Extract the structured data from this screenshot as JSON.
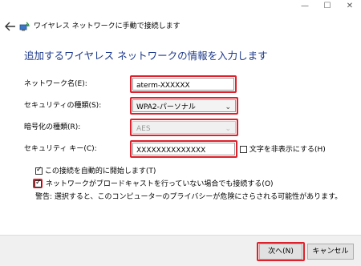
{
  "window": {
    "title": "ワイヤレス ネットワークに手動で接続します",
    "minimize": "—",
    "maximize": "☐",
    "close": "✕",
    "back_icon": "arrow-left-icon"
  },
  "heading": "追加するワイヤレス ネットワークの情報を入力します",
  "form": {
    "network_name_label": "ネットワーク名(E):",
    "network_name_value": "aterm-XXXXXX",
    "security_type_label": "セキュリティの種類(S):",
    "security_type_value": "WPA2-パーソナル",
    "encryption_label": "暗号化の種類(R):",
    "encryption_value": "AES",
    "security_key_label": "セキュリティ キー(C):",
    "security_key_value": "XXXXXXXXXXXXXX",
    "hide_chars_label": "文字を非表示にする(H)"
  },
  "options": {
    "auto_connect_label": "この接続を自動的に開始します(T)",
    "auto_connect_checked": true,
    "connect_hidden_label": "ネットワークがブロードキャストを行っていない場合でも接続する(O)",
    "connect_hidden_checked": true,
    "warning": "警告: 選択すると、このコンピューターのプライバシーが危険にさらされる可能性があります。"
  },
  "buttons": {
    "next": "次へ(N)",
    "cancel": "キャンセル"
  },
  "colors": {
    "highlight": "#e0202a",
    "heading": "#1e3a8a"
  }
}
